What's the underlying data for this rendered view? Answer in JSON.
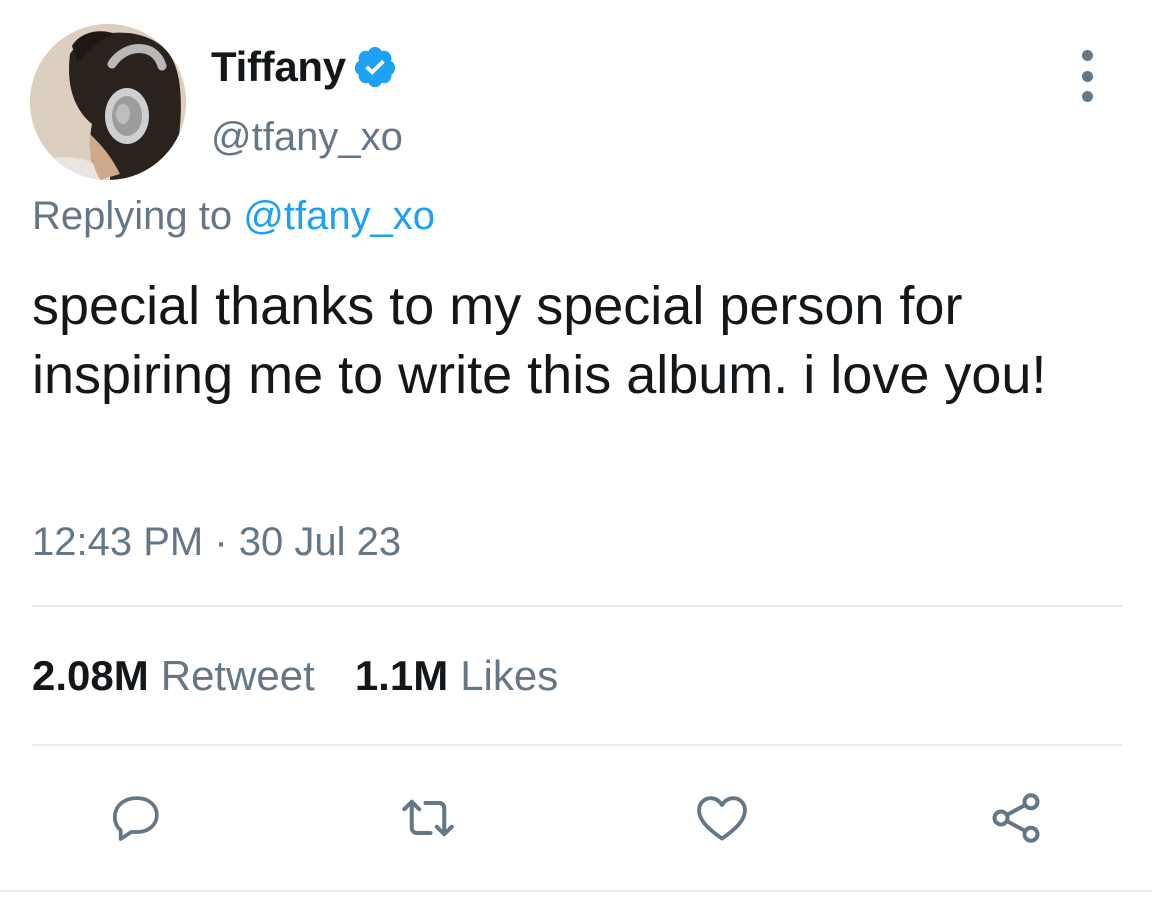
{
  "author": {
    "display_name": "Tiffany",
    "handle": "@tfany_xo",
    "verified": true,
    "avatar_icon": "profile-photo-headphones"
  },
  "reply": {
    "prefix": "Replying to ",
    "mention": "@tfany_xo"
  },
  "tweet": {
    "text": "special thanks to my special person for inspiring me to write this album. i love you!",
    "timestamp": "12:43 PM · 30 Jul 23"
  },
  "stats": {
    "retweets_count": "2.08M",
    "retweets_label": "Retweet",
    "likes_count": "1.1M",
    "likes_label": "Likes"
  },
  "actions": [
    {
      "name": "reply",
      "icon": "reply-icon"
    },
    {
      "name": "retweet",
      "icon": "retweet-icon"
    },
    {
      "name": "like",
      "icon": "heart-icon"
    },
    {
      "name": "share",
      "icon": "share-icon"
    }
  ],
  "colors": {
    "accent": "#1da1f2",
    "secondary_text": "#657786",
    "primary_text": "#14171a",
    "divider": "#e6ecf0"
  }
}
